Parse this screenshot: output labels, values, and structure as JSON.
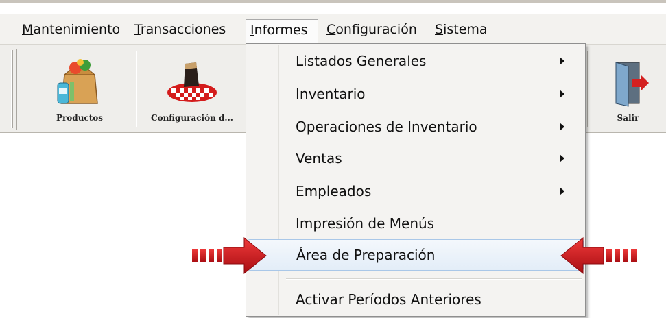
{
  "menubar": {
    "items": [
      {
        "label": "Mantenimiento",
        "accel": "M",
        "rest": "antenimiento"
      },
      {
        "label": "Transacciones",
        "accel": "T",
        "rest": "ransacciones"
      },
      {
        "label": "Informes",
        "accel": "I",
        "rest": "nformes"
      },
      {
        "label": "Configuración",
        "accel": "C",
        "rest": "onfiguración"
      },
      {
        "label": "Sistema",
        "accel": "S",
        "rest": "istema"
      }
    ]
  },
  "toolbar": {
    "items": [
      {
        "label": "Productos",
        "icon": "grocery-bag-icon"
      },
      {
        "label": "Configuración d...",
        "icon": "table-setting-icon"
      },
      {
        "label": "Salir",
        "icon": "exit-door-icon"
      }
    ]
  },
  "dropdown": {
    "items": [
      {
        "label": "Listados Generales",
        "submenu": true
      },
      {
        "label": "Inventario",
        "submenu": true
      },
      {
        "label": "Operaciones de Inventario",
        "submenu": true
      },
      {
        "label": "Ventas",
        "submenu": true
      },
      {
        "label": "Empleados",
        "submenu": true
      },
      {
        "label": "Impresión de Menús",
        "submenu": false
      },
      {
        "label": "Área de Preparación",
        "submenu": false,
        "highlighted": true
      },
      {
        "label": "Activar Períodos Anteriores",
        "submenu": false
      }
    ]
  },
  "colors": {
    "highlight": "#e3edf8",
    "callout_arrow": "#c8141a"
  }
}
